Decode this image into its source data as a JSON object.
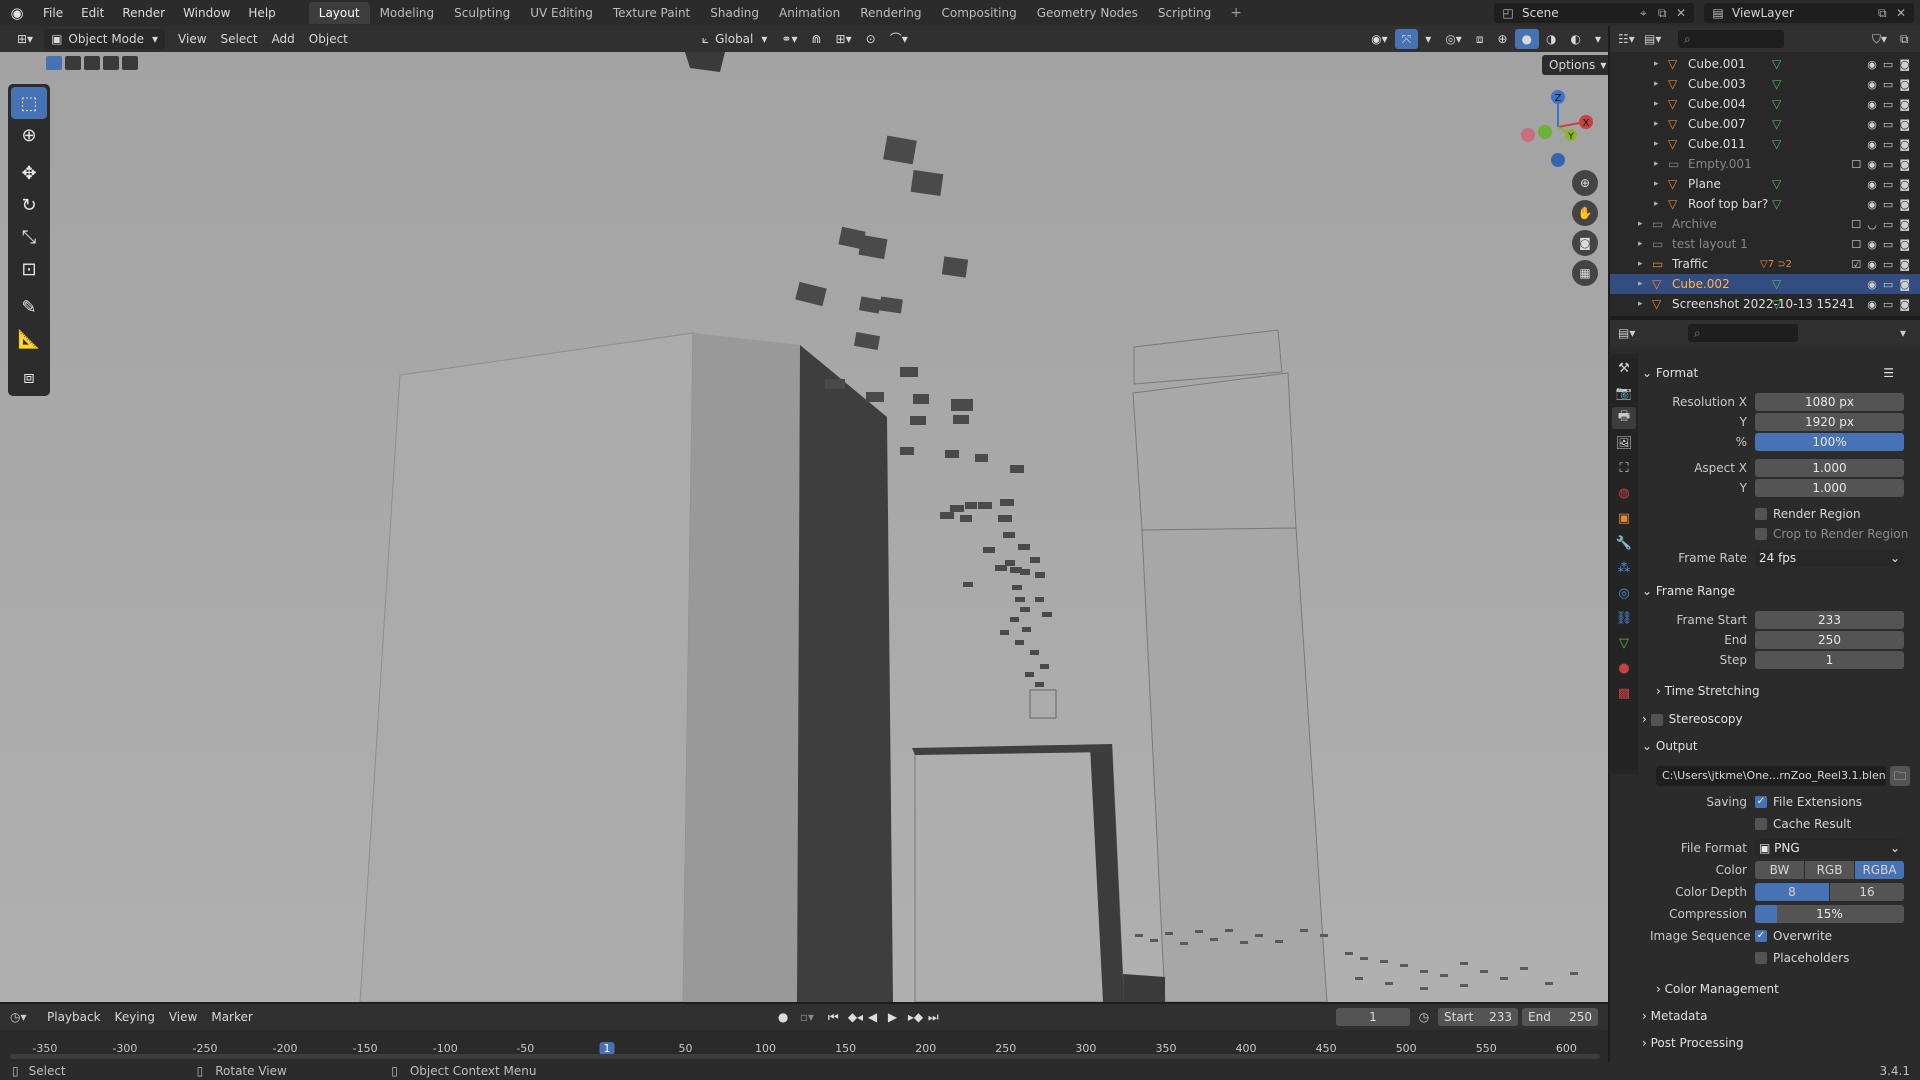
{
  "app": {
    "menus": [
      "File",
      "Edit",
      "Render",
      "Window",
      "Help"
    ],
    "workspaces": [
      "Layout",
      "Modeling",
      "Sculpting",
      "UV Editing",
      "Texture Paint",
      "Shading",
      "Animation",
      "Rendering",
      "Compositing",
      "Geometry Nodes",
      "Scripting"
    ],
    "active_workspace": "Layout",
    "add_workspace": "+",
    "scene": "Scene",
    "view_layer": "ViewLayer",
    "version": "3.4.1"
  },
  "viewport_header": {
    "mode": "Object Mode",
    "menus": [
      "View",
      "Select",
      "Add",
      "Object"
    ],
    "orientation": "Global",
    "options": "Options"
  },
  "gizmo": {
    "z": "Z",
    "y": "Y",
    "x": "X"
  },
  "outliner": {
    "rows": [
      {
        "name": "Cube.001",
        "indent": 1,
        "dim": false
      },
      {
        "name": "Cube.003",
        "indent": 1,
        "dim": false
      },
      {
        "name": "Cube.004",
        "indent": 1,
        "dim": false
      },
      {
        "name": "Cube.007",
        "indent": 1,
        "dim": false
      },
      {
        "name": "Cube.011",
        "indent": 1,
        "dim": false
      },
      {
        "name": "Empty.001",
        "indent": 1,
        "dim": true
      },
      {
        "name": "Plane",
        "indent": 1,
        "dim": false
      },
      {
        "name": "Roof top bar?",
        "indent": 1,
        "dim": false
      },
      {
        "name": "Archive",
        "indent": 0,
        "dim": true
      },
      {
        "name": "test layout 1",
        "indent": 0,
        "dim": true
      },
      {
        "name": "Traffic",
        "indent": 0,
        "dim": false
      },
      {
        "name": "Cube.002",
        "indent": 0,
        "dim": false,
        "selected": true
      },
      {
        "name": "Screenshot 2022-10-13 15241",
        "indent": 0,
        "dim": false
      }
    ],
    "traffic_badges": [
      "7",
      "2"
    ]
  },
  "properties": {
    "format": {
      "title": "Format",
      "resolution_x_label": "Resolution X",
      "resolution_x": "1080 px",
      "y_label": "Y",
      "resolution_y": "1920 px",
      "pct_label": "%",
      "resolution_pct": "100%",
      "aspect_x_label": "Aspect X",
      "aspect_x": "1.000",
      "aspect_y": "1.000",
      "render_region": "Render Region",
      "crop": "Crop to Render Region",
      "frame_rate_label": "Frame Rate",
      "frame_rate": "24 fps"
    },
    "frame_range": {
      "title": "Frame Range",
      "start_label": "Frame Start",
      "start": "233",
      "end_label": "End",
      "end": "250",
      "step_label": "Step",
      "step": "1",
      "time_stretching": "Time Stretching"
    },
    "stereoscopy": "Stereoscopy",
    "output": {
      "title": "Output",
      "path": "C:\\Users\\jtkme\\One...rnZoo_Reel3.1.blend",
      "saving_label": "Saving",
      "file_extensions": "File Extensions",
      "cache_result": "Cache Result",
      "file_format_label": "File Format",
      "file_format": "PNG",
      "color_label": "Color",
      "color_options": [
        "BW",
        "RGB",
        "RGBA"
      ],
      "color_selected": "RGBA",
      "color_depth_label": "Color Depth",
      "color_depth_options": [
        "8",
        "16"
      ],
      "color_depth_selected": "8",
      "compression_label": "Compression",
      "compression": "15%",
      "compression_value": 0.15,
      "image_sequence_label": "Image Sequence",
      "overwrite": "Overwrite",
      "placeholders": "Placeholders",
      "color_management": "Color Management"
    },
    "metadata": "Metadata",
    "post_processing": "Post Processing"
  },
  "timeline": {
    "menus": [
      "Playback",
      "Keying",
      "View",
      "Marker"
    ],
    "current_frame": "1",
    "start_label": "Start",
    "start": "233",
    "end_label": "End",
    "end": "250",
    "ticks": [
      "-350",
      "-300",
      "-250",
      "-200",
      "-150",
      "-100",
      "-50",
      "1",
      "50",
      "100",
      "150",
      "200",
      "250",
      "300",
      "350",
      "400",
      "450",
      "500",
      "550",
      "600"
    ]
  },
  "statusbar": {
    "select": "Select",
    "rotate": "Rotate View",
    "context": "Object Context Menu"
  }
}
